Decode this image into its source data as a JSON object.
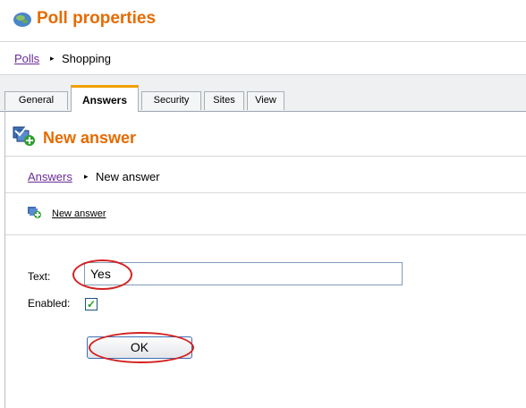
{
  "header": {
    "title": "Poll properties",
    "icon": "globe-icon"
  },
  "breadcrumb_top": {
    "link": "Polls",
    "separator": "▸",
    "current": "Shopping"
  },
  "tabs": [
    {
      "label": "General",
      "active": false
    },
    {
      "label": "Answers",
      "active": true
    },
    {
      "label": "Security",
      "active": false
    },
    {
      "label": "Sites",
      "active": false
    },
    {
      "label": "View",
      "active": false
    }
  ],
  "section": {
    "title": "New answer",
    "icon": "new-answer-icon"
  },
  "breadcrumb_inner": {
    "link": "Answers",
    "separator": "▸",
    "current": "New answer"
  },
  "action": {
    "label": "New answer",
    "icon": "new-answer-icon"
  },
  "form": {
    "text_label": "Text:",
    "text_value": "Yes",
    "enabled_label": "Enabled:",
    "enabled_checked": true,
    "check_mark": "✓",
    "ok_label": "OK"
  },
  "colors": {
    "accent": "#e66b00",
    "link": "#6a2a96",
    "highlight_ring": "#d42020"
  }
}
